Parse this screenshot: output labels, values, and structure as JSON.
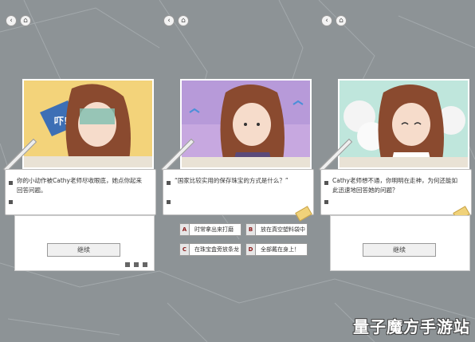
{
  "panels": [
    {
      "dialog": "你的小动作被Cathy老师尽收眼底，她点你起来回答问题。",
      "bubble_text": "吓!",
      "continue_label": "继续"
    },
    {
      "dialog": "“国家比较实用的保存珠宝的方式是什么？”",
      "choices": [
        {
          "key": "A",
          "label": "时常拿出来打磨"
        },
        {
          "key": "B",
          "label": "放在真空塑料袋中"
        },
        {
          "key": "C",
          "label": "在珠宝盒旁放条龙"
        },
        {
          "key": "D",
          "label": "全部戴在身上！"
        }
      ]
    },
    {
      "dialog": "Cathy老师想不通，你明明在走神，为何还能如此迅速地回答她的问题？",
      "continue_label": "继续"
    }
  ],
  "nav": {
    "back_glyph": "‹",
    "home_glyph": "⌂"
  },
  "watermark": "量子魔方手游站",
  "colors": {
    "bg": "#8d9396",
    "panel1_art": "#f3d37a",
    "panel2_art": "#c7a8e0",
    "panel3_art": "#bfe6dc",
    "hair": "#8a4a2f",
    "choice_key": "#8a1b1b"
  }
}
